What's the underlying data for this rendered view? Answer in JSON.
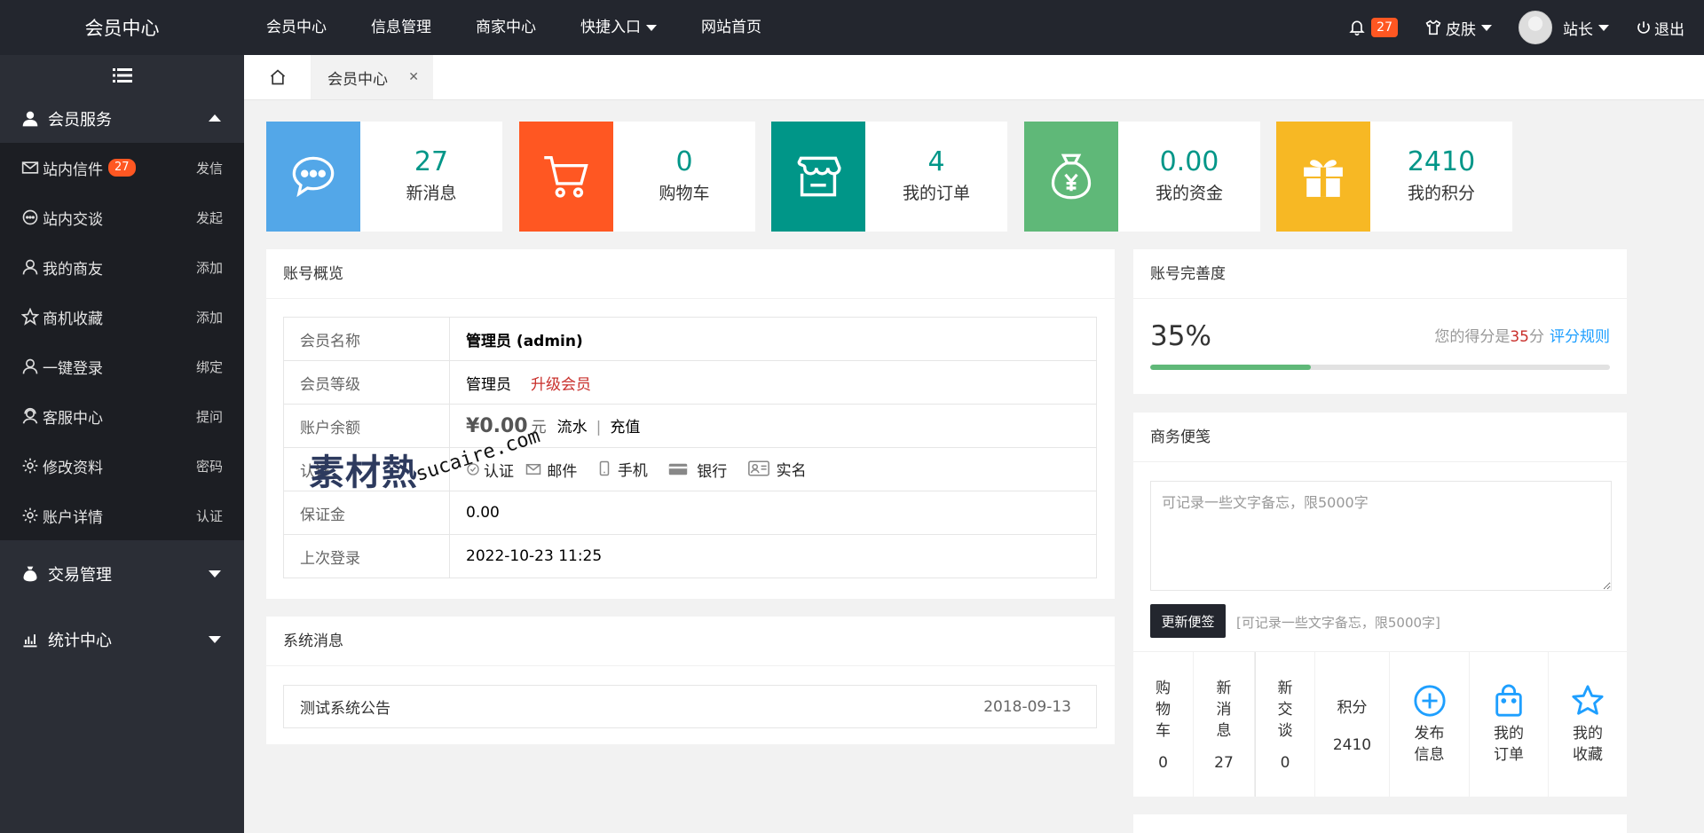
{
  "app": {
    "title": "会员中心"
  },
  "topnav": [
    {
      "label": "会员中心",
      "dropdown": false
    },
    {
      "label": "信息管理",
      "dropdown": false
    },
    {
      "label": "商家中心",
      "dropdown": false
    },
    {
      "label": "快捷入口",
      "dropdown": true
    },
    {
      "label": "网站首页",
      "dropdown": false
    }
  ],
  "topright": {
    "notify_count": "27",
    "skin_label": "皮肤",
    "user_label": "站长",
    "logout_label": "退出"
  },
  "sidebar": {
    "groups": [
      {
        "label": "会员服务",
        "icon": "user-icon",
        "expanded": true
      },
      {
        "label": "交易管理",
        "icon": "money-bag-icon",
        "expanded": false
      },
      {
        "label": "统计中心",
        "icon": "stats-icon",
        "expanded": false
      }
    ],
    "items": [
      {
        "label": "站内信件",
        "icon": "mail-icon",
        "badge": "27",
        "action": "发信"
      },
      {
        "label": "站内交谈",
        "icon": "chat-icon",
        "action": "发起"
      },
      {
        "label": "我的商友",
        "icon": "user-icon",
        "action": "添加"
      },
      {
        "label": "商机收藏",
        "icon": "star-icon",
        "action": "添加"
      },
      {
        "label": "一键登录",
        "icon": "user-icon",
        "action": "绑定"
      },
      {
        "label": "客服中心",
        "icon": "support-icon",
        "action": "提问"
      },
      {
        "label": "修改资料",
        "icon": "gear-icon",
        "action": "密码"
      },
      {
        "label": "账户详情",
        "icon": "gear-icon",
        "action": "认证"
      }
    ]
  },
  "tabs": {
    "active": "会员中心"
  },
  "stats": [
    {
      "value": "27",
      "label": "新消息",
      "color": "#53a7e8",
      "icon": "chat-bubble-icon"
    },
    {
      "value": "0",
      "label": "购物车",
      "color": "#ff5722",
      "icon": "cart-icon"
    },
    {
      "value": "4",
      "label": "我的订单",
      "color": "#009688",
      "icon": "store-icon"
    },
    {
      "value": "0.00",
      "label": "我的资金",
      "color": "#5fb878",
      "icon": "money-bag-icon"
    },
    {
      "value": "2410",
      "label": "我的积分",
      "color": "#f7b824",
      "icon": "gift-icon"
    }
  ],
  "account": {
    "title": "账号概览",
    "name_key": "会员名称",
    "name_val": "管理员 (admin)",
    "level_key": "会员等级",
    "level_val": "管理员",
    "upgrade": "升级会员",
    "balance_key": "账户余额",
    "currency": "¥",
    "balance": "0.00",
    "unit": "元",
    "flow": "流水",
    "sep": "|",
    "recharge": "充值",
    "verify_key": "认证",
    "verify_items": [
      "认证",
      "邮件",
      "手机",
      "银行",
      "实名"
    ],
    "deposit_key": "保证金",
    "deposit_val": "0.00",
    "login_key": "上次登录",
    "login_val": "2022-10-23 11:25"
  },
  "system": {
    "title": "系统消息",
    "notice": "测试系统公告",
    "date": "2018-09-13"
  },
  "completeness": {
    "title": "账号完善度",
    "percent": "35%",
    "score_prefix": "您的得分是",
    "score": "35",
    "score_suffix": "分",
    "rules": "评分规则",
    "progress": 0.35
  },
  "memo": {
    "title": "商务便笺",
    "placeholder": "可记录一些文字备忘，限5000字",
    "button": "更新便签",
    "hint": "[可记录一些文字备忘，限5000字]"
  },
  "quick": [
    {
      "label": "购物车",
      "value": "0"
    },
    {
      "label": "新消息",
      "value": "27"
    },
    {
      "label": "新交谈",
      "value": "0"
    },
    {
      "label": "积分",
      "value": "2410"
    },
    {
      "label": "发布信息",
      "icon": "plus-circle-icon"
    },
    {
      "label": "我的订单",
      "icon": "bag-icon"
    },
    {
      "label": "我的收藏",
      "icon": "star-icon"
    }
  ],
  "watermark": {
    "logo": "素材熱",
    "url": "sucaire.com"
  }
}
